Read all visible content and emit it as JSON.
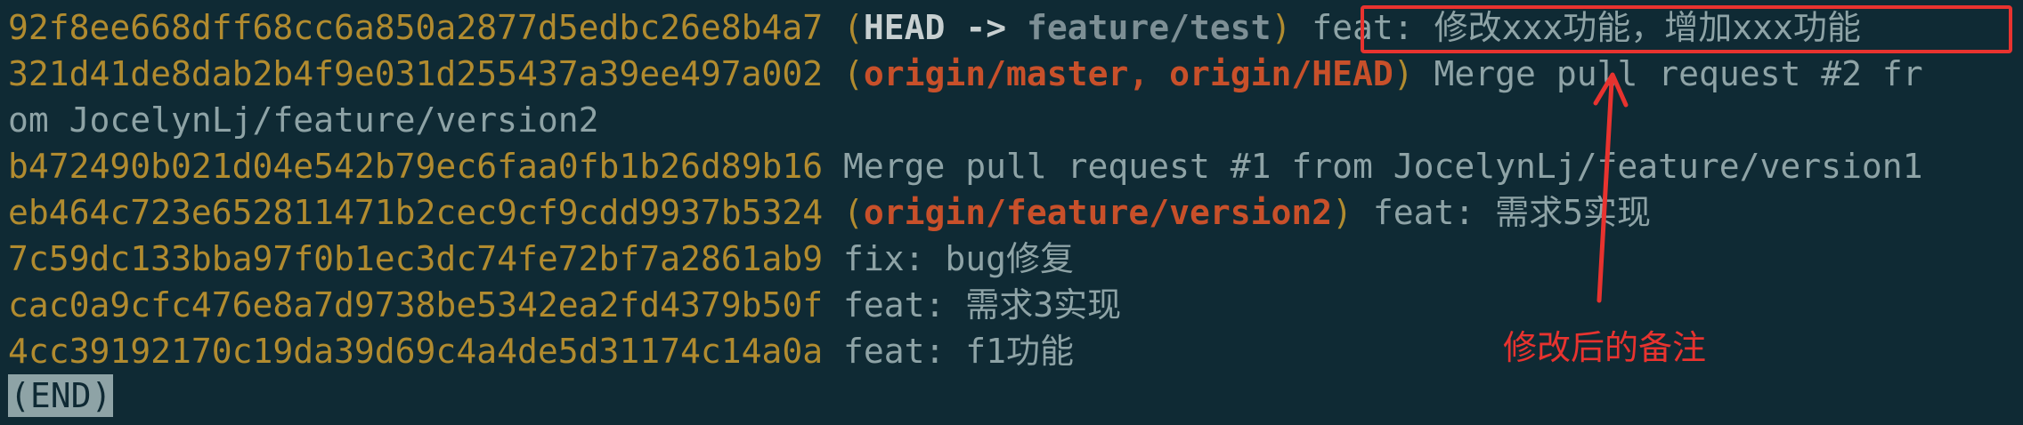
{
  "terminal": {
    "lines": [
      {
        "hash": "92f8ee668dff68cc6a850a2877d5edbc26e8b4a7",
        "head": "HEAD",
        "arrow": "->",
        "branch": "feature/test",
        "message": "feat: 修改xxx功能，增加xxx功能"
      },
      {
        "hash": "321d41de8dab2b4f9e031d255437a39ee497a002",
        "ref1": "origin/master",
        "ref2": "origin/HEAD",
        "message": "Merge pull request #2 fr"
      },
      {
        "wrap": "om JocelynLj/feature/version2"
      },
      {
        "hash": "b472490b021d04e542b79ec6faa0fb1b26d89b16",
        "message": "Merge pull request #1 from JocelynLj/feature/version1"
      },
      {
        "hash": "eb464c723e652811471b2cec9cf9cdd9937b5324",
        "ref1": "origin/feature/version2",
        "message": "feat: 需求5实现"
      },
      {
        "hash": "7c59dc133bba97f0b1ec3dc74fe72bf7a2861ab9",
        "message": "fix: bug修复"
      },
      {
        "hash": "cac0a9cfc476e8a7d9738be5342ea2fd4379b50f",
        "message": "feat: 需求3实现"
      },
      {
        "hash": "4cc39192170c19da39d69c4a4de5d31174c14a0a",
        "message": "feat: f1功能"
      }
    ],
    "end_marker": "(END)"
  },
  "annotation": {
    "label": "修改后的备注",
    "color": "#e8332f"
  }
}
